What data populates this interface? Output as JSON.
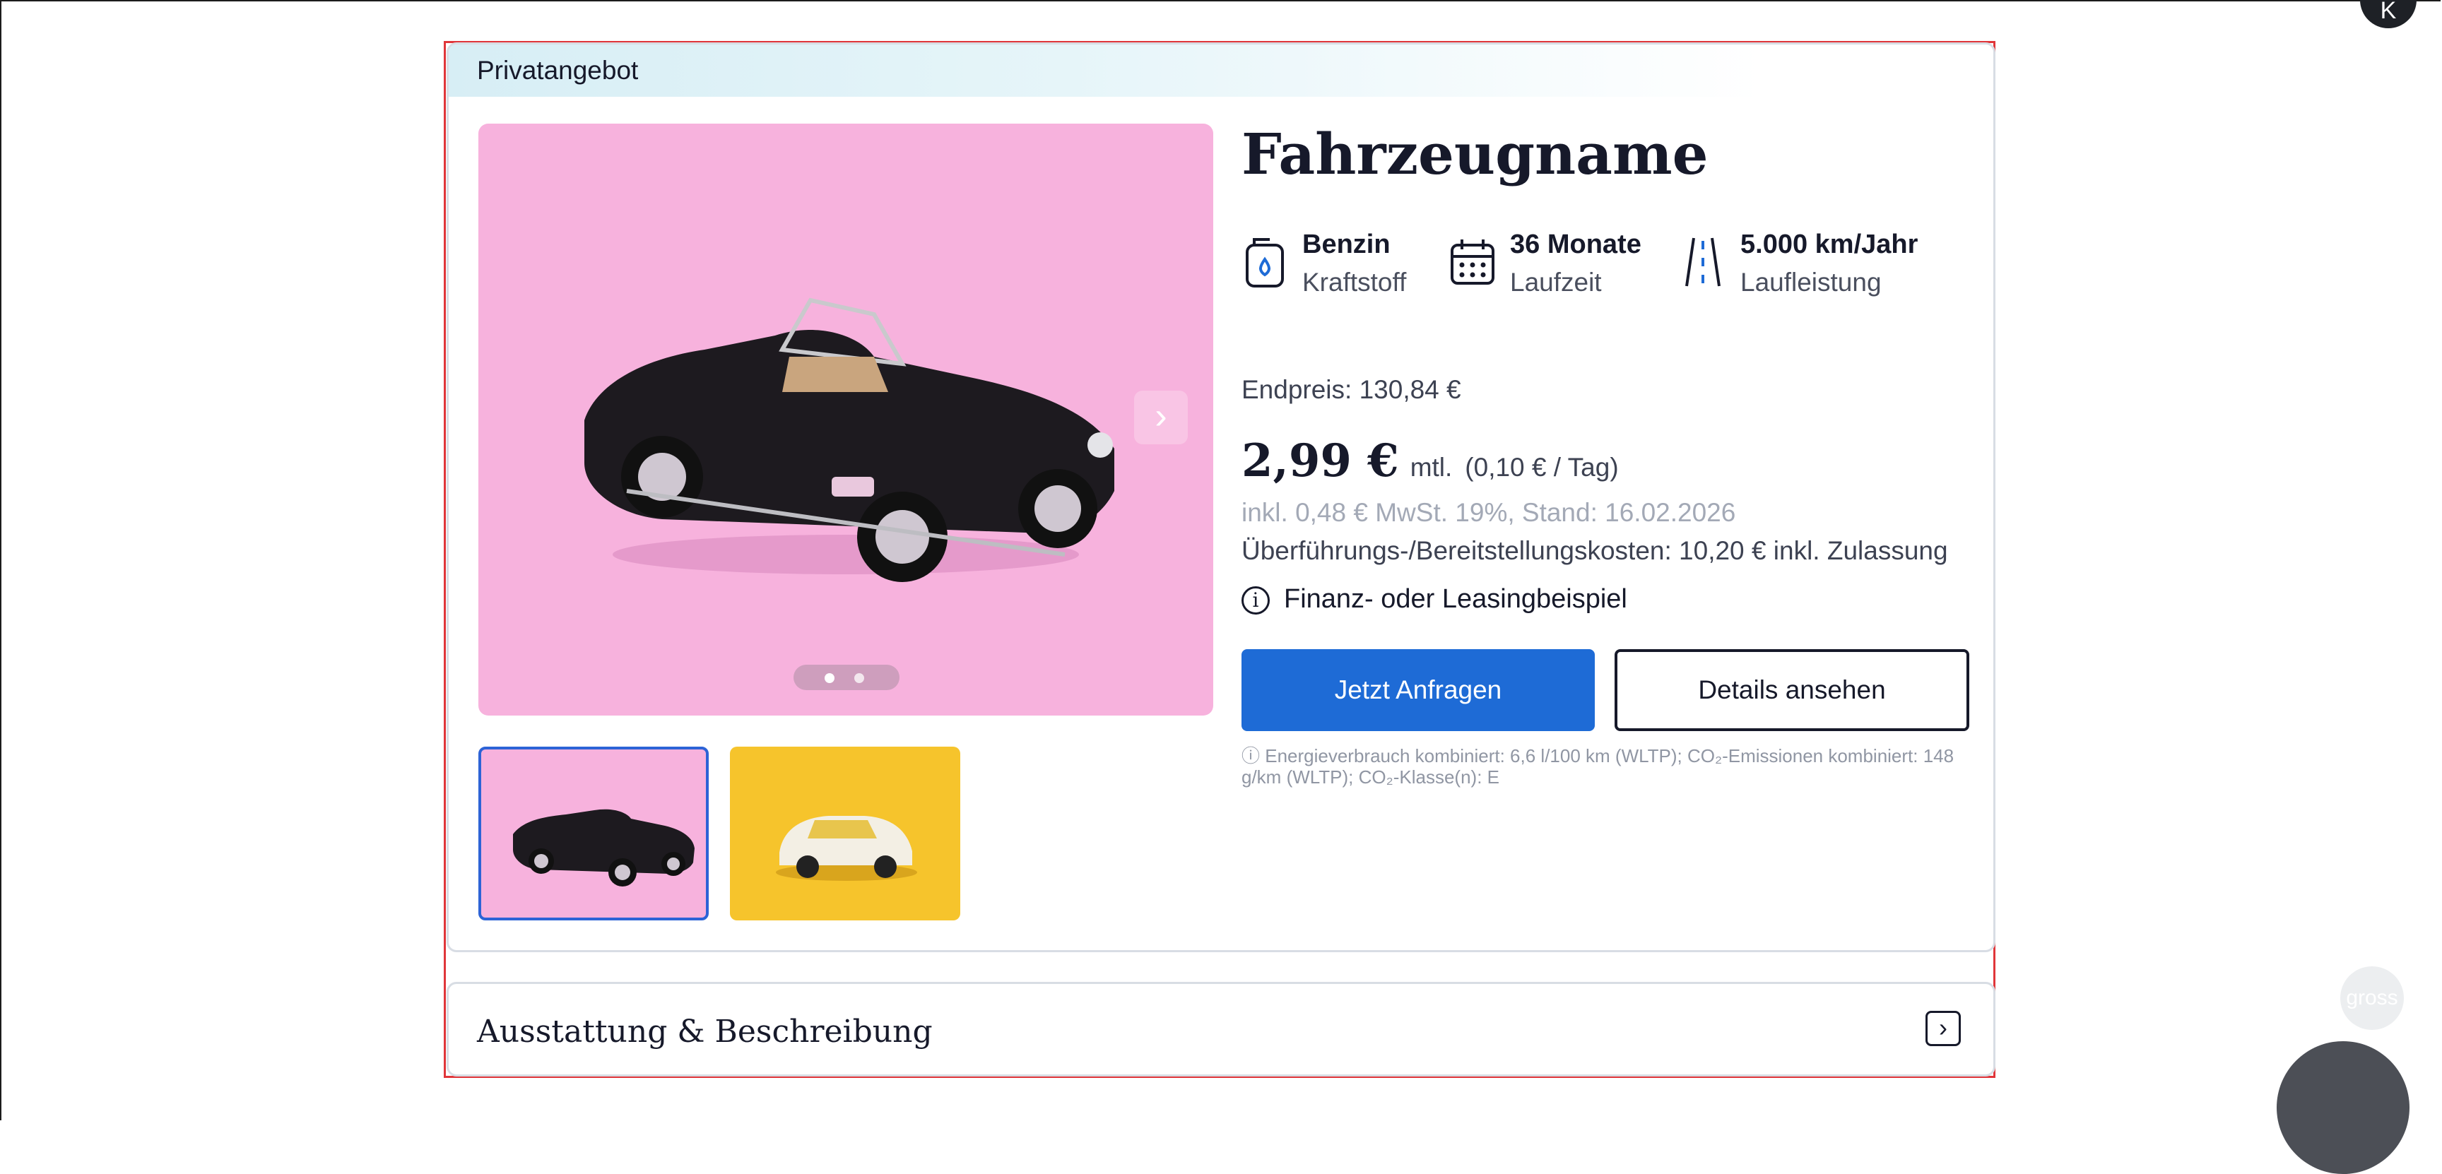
{
  "banner": {
    "label": "Privatangebot"
  },
  "vehicle": {
    "title": "Fahrzeugname",
    "specs": [
      {
        "value": "Benzin",
        "label": "Kraftstoff",
        "icon": "fuel-can-icon"
      },
      {
        "value": "36 Monate",
        "label": "Laufzeit",
        "icon": "calendar-icon"
      },
      {
        "value": "5.000 km/Jahr",
        "label": "Laufleistung",
        "icon": "road-icon"
      }
    ]
  },
  "pricing": {
    "endpreis": "Endpreis: 130,84 €",
    "monthly": "2,99 €",
    "monthly_suffix": "mtl.",
    "per_day": "(0,10 € / Tag)",
    "vat_note": "inkl. 0,48 € MwSt. 19%, Stand: 16.02.2026",
    "transfer_costs": "Überführungs-/Bereitstellungskosten: 10,20 € inkl. Zulassung",
    "finance_example": "Finanz- oder Leasingbeispiel"
  },
  "actions": {
    "primary": "Jetzt Anfragen",
    "secondary": "Details ansehen"
  },
  "energy": {
    "text": "ⓘ Energieverbrauch kombiniert: 6,6 l/100 km (WLTP); CO₂-Emissionen kombiniert: 148 g/km (WLTP); CO₂-Klasse(n): E"
  },
  "gallery": {
    "images": [
      {
        "alt": "black convertible model car on pink background",
        "bg": "#f7b2dd"
      },
      {
        "alt": "white compact model car on yellow background",
        "bg": "#f6c42c"
      }
    ],
    "active_index": 0,
    "image_count": 2
  },
  "accordion": {
    "title": "Ausstattung & Beschreibung"
  },
  "floating": {
    "avatar_letter": "K",
    "gross_label": "gross"
  },
  "colors": {
    "primary": "#1e6bd6",
    "highlight_border": "#e0363a",
    "pink_bg": "#f7b2dd",
    "yellow_bg": "#f6c42c"
  }
}
